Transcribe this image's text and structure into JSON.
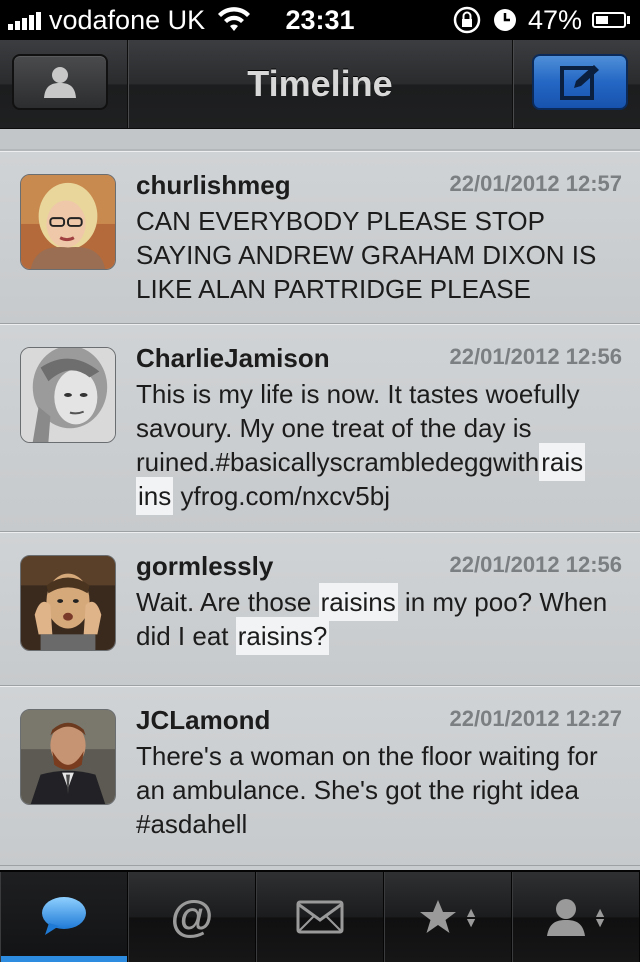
{
  "status_bar": {
    "carrier": "vodafone UK",
    "time": "23:31",
    "battery": "47%",
    "battery_level": 0.47
  },
  "nav": {
    "title": "Timeline",
    "left_icon": "person-icon",
    "right_icon": "compose-icon"
  },
  "tweets": [
    {
      "author": "churlishmeg",
      "time": "22/01/2012 12:57",
      "text": "CAN EVERYBODY PLEASE STOP SAYING ANDREW GRAHAM DIXON IS LIKE ALAN PARTRIDGE PLEASE"
    },
    {
      "author": "CharlieJamison",
      "time": "22/01/2012 12:56",
      "text_parts": [
        "This is my life is now. It tastes woefully savoury. My one treat of the day is ruined.#basicallyscrambledeggwith",
        "rais",
        "ins",
        " yfrog.com/nxcv5bj"
      ]
    },
    {
      "author": "gormlessly",
      "time": "22/01/2012 12:56",
      "text_parts": [
        "Wait. Are those ",
        "raisins",
        " in my poo? When did I eat ",
        "raisins?"
      ]
    },
    {
      "author": "JCLamond",
      "time": "22/01/2012 12:27",
      "text": "There's a woman on the floor waiting for an ambulance. She's got the right idea #asdahell"
    }
  ],
  "tabs": [
    {
      "icon": "speech-bubble-icon",
      "active": true
    },
    {
      "icon": "at-sign-icon",
      "label": "@"
    },
    {
      "icon": "envelope-icon"
    },
    {
      "icon": "star-icon",
      "updown": "▲▼"
    },
    {
      "icon": "person-icon",
      "updown": "▲▼"
    }
  ],
  "colors": {
    "accent": "#2e8ce0",
    "compose_button": "#2467c4",
    "timestamp": "#7c7f81"
  }
}
